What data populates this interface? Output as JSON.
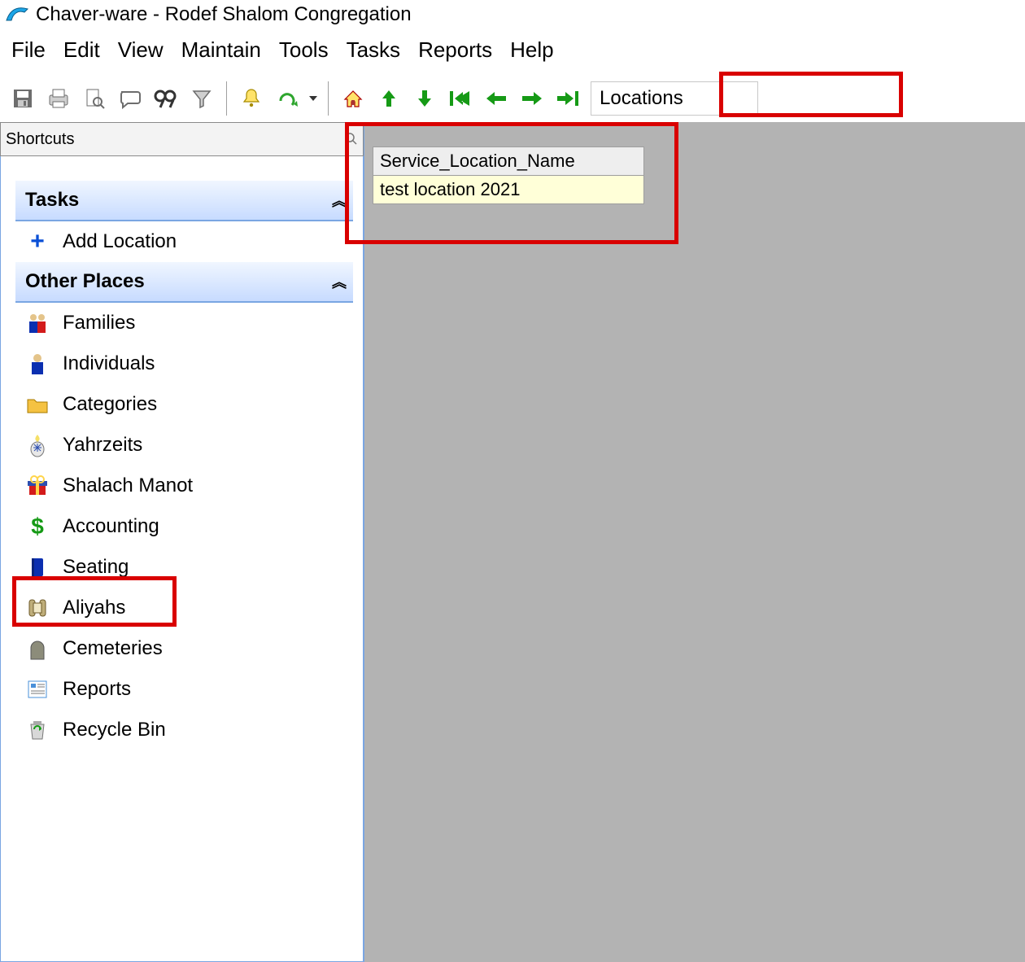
{
  "window": {
    "title": "Chaver-ware - Rodef Shalom Congregation"
  },
  "menu": {
    "items": [
      "File",
      "Edit",
      "View",
      "Maintain",
      "Tools",
      "Tasks",
      "Reports",
      "Help"
    ]
  },
  "toolbar": {
    "locations_label": "Locations"
  },
  "shortcuts": {
    "header": "Shortcuts",
    "sections": {
      "tasks": {
        "title": "Tasks",
        "items": [
          {
            "key": "add-location",
            "label": "Add Location"
          }
        ]
      },
      "other": {
        "title": "Other Places",
        "items": [
          {
            "key": "families",
            "label": "Families"
          },
          {
            "key": "individuals",
            "label": "Individuals"
          },
          {
            "key": "categories",
            "label": "Categories"
          },
          {
            "key": "yahrzeits",
            "label": "Yahrzeits"
          },
          {
            "key": "shalach-manot",
            "label": "Shalach Manot"
          },
          {
            "key": "accounting",
            "label": "Accounting"
          },
          {
            "key": "seating",
            "label": "Seating"
          },
          {
            "key": "aliyahs",
            "label": "Aliyahs"
          },
          {
            "key": "cemeteries",
            "label": "Cemeteries"
          },
          {
            "key": "reports",
            "label": "Reports"
          },
          {
            "key": "recycle-bin",
            "label": "Recycle Bin"
          }
        ]
      }
    }
  },
  "grid": {
    "column_header": "Service_Location_Name",
    "rows": [
      "test location 2021"
    ]
  }
}
